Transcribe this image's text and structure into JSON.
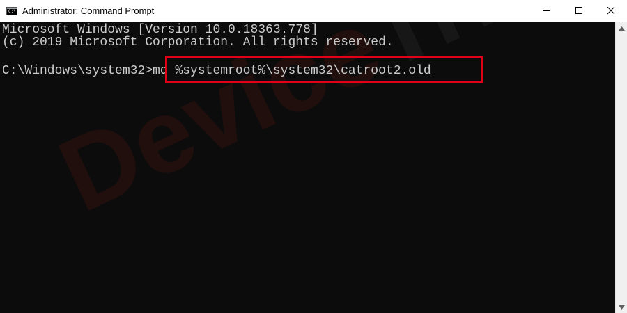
{
  "window": {
    "title": "Administrator: Command Prompt",
    "icon_text": "C:\\"
  },
  "controls": {
    "minimize": "minimize-icon",
    "maximize": "maximize-icon",
    "close": "close-icon"
  },
  "console": {
    "lines": [
      "Microsoft Windows [Version 10.0.18363.778]",
      "(c) 2019 Microsoft Corporation. All rights reserved.",
      "C:\\Windows\\system32>md %systemroot%\\system32\\catroot2.old"
    ],
    "highlight_color": "#e0001a",
    "text_color": "#cccccc",
    "background": "#0c0c0c"
  },
  "watermark": {
    "part1": "Device",
    "part2": "Tricks"
  }
}
